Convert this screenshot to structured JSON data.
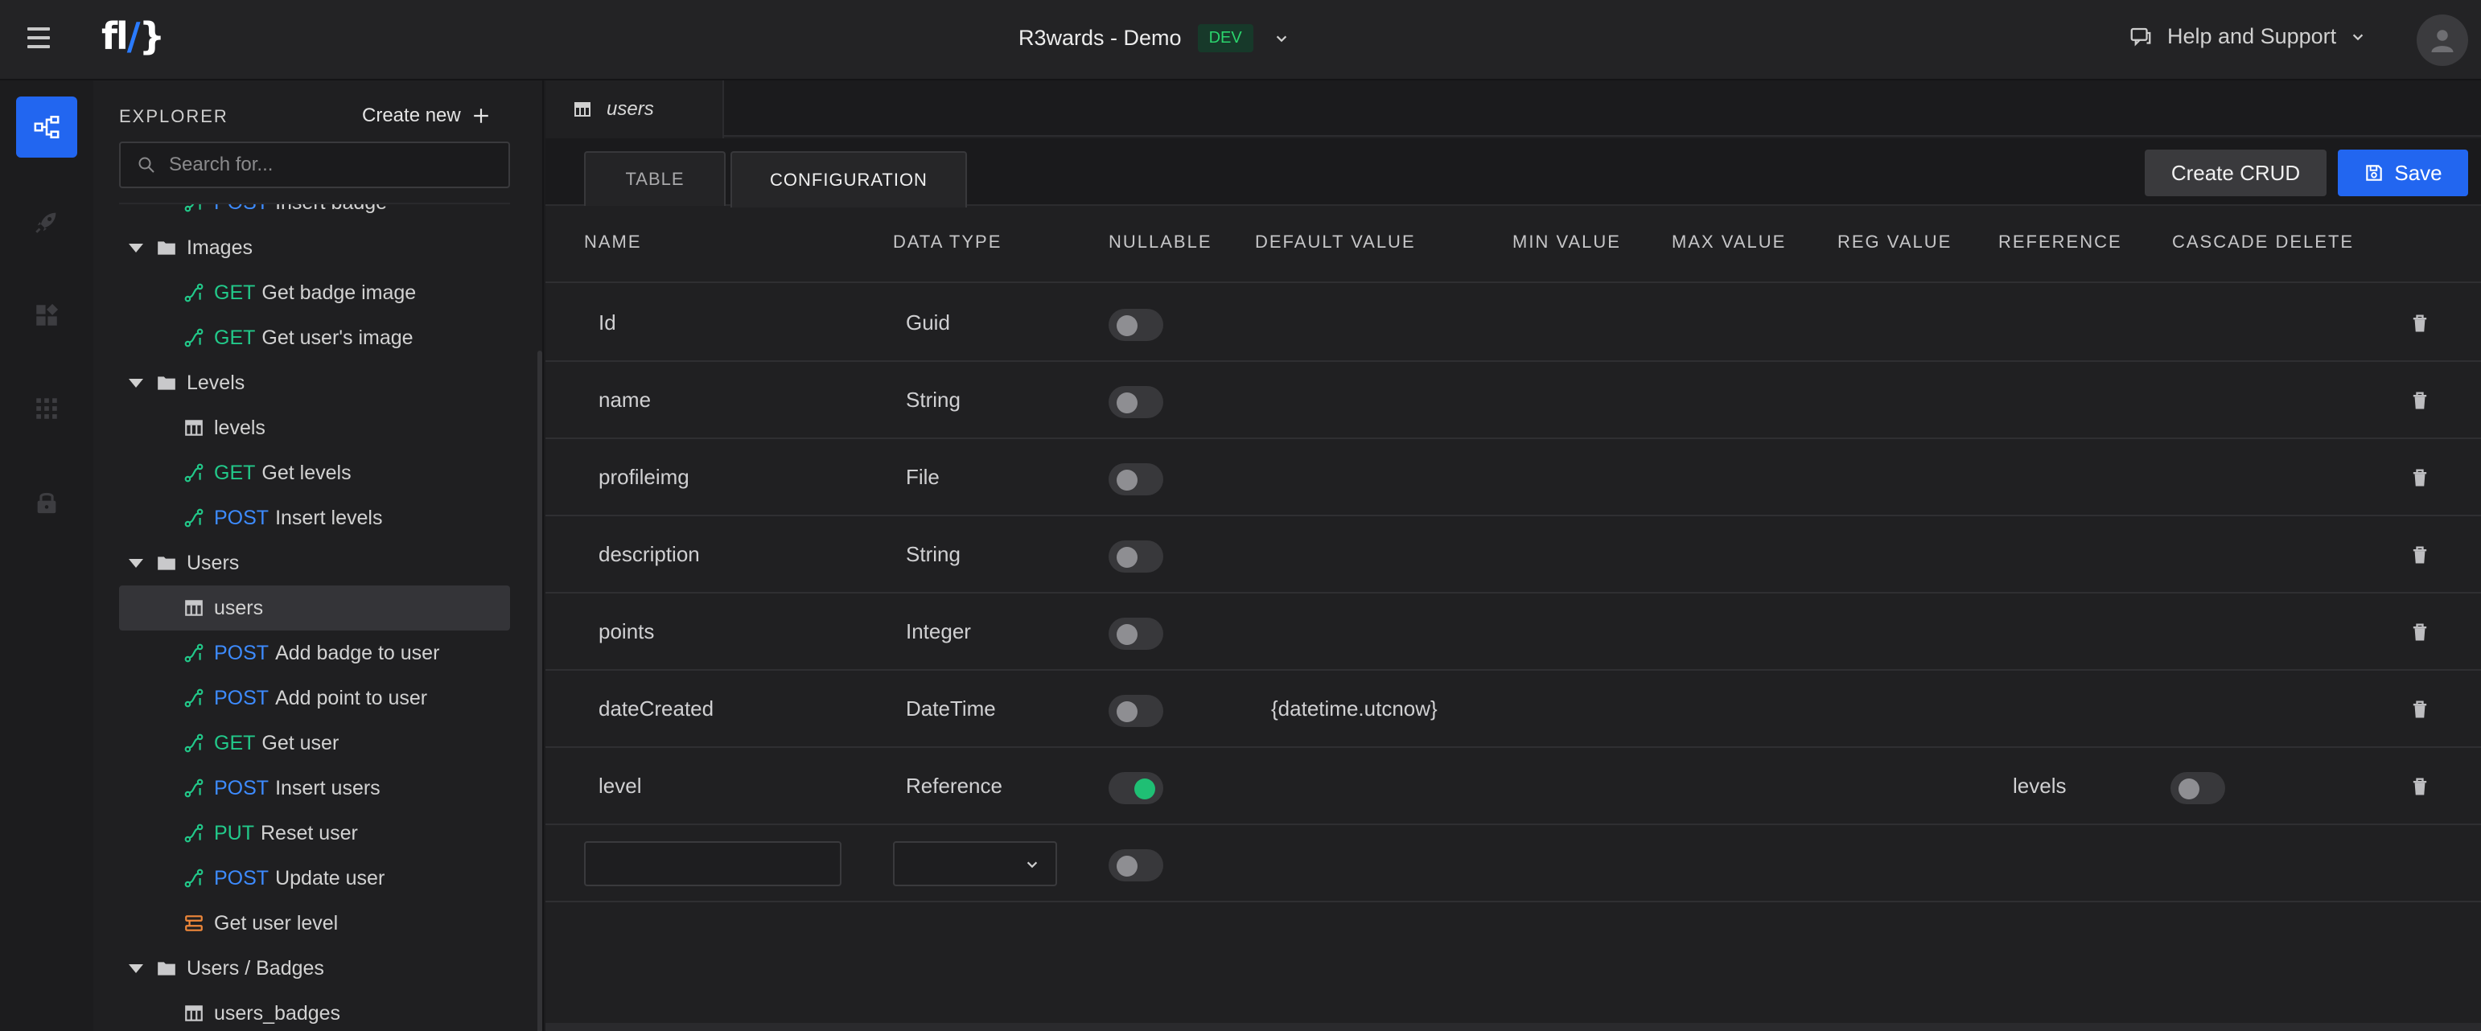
{
  "header": {
    "logo": "fl/}",
    "project_name": "R3wards - Demo",
    "env_badge": "DEV",
    "help_label": "Help and Support"
  },
  "explorer": {
    "title": "EXPLORER",
    "create_new": "Create new",
    "search_placeholder": "Search for...",
    "items": [
      {
        "kind": "leaf",
        "type": "endpoint",
        "method": "POST",
        "label": "Insert badge"
      },
      {
        "kind": "folder",
        "label": "Images"
      },
      {
        "kind": "leaf",
        "type": "endpoint",
        "method": "GET",
        "label": "Get badge image"
      },
      {
        "kind": "leaf",
        "type": "endpoint",
        "method": "GET",
        "label": "Get user's image"
      },
      {
        "kind": "folder",
        "label": "Levels"
      },
      {
        "kind": "leaf",
        "type": "table",
        "method": "",
        "label": "levels"
      },
      {
        "kind": "leaf",
        "type": "endpoint",
        "method": "GET",
        "label": "Get levels"
      },
      {
        "kind": "leaf",
        "type": "endpoint",
        "method": "POST",
        "label": "Insert levels"
      },
      {
        "kind": "folder",
        "label": "Users"
      },
      {
        "kind": "leaf",
        "type": "table",
        "method": "",
        "label": "users",
        "selected": true
      },
      {
        "kind": "leaf",
        "type": "endpoint",
        "method": "POST",
        "label": "Add badge to user"
      },
      {
        "kind": "leaf",
        "type": "endpoint",
        "method": "POST",
        "label": "Add point to user"
      },
      {
        "kind": "leaf",
        "type": "endpoint",
        "method": "GET",
        "label": "Get user"
      },
      {
        "kind": "leaf",
        "type": "endpoint",
        "method": "POST",
        "label": "Insert users"
      },
      {
        "kind": "leaf",
        "type": "endpoint",
        "method": "PUT",
        "label": "Reset user"
      },
      {
        "kind": "leaf",
        "type": "endpoint",
        "method": "POST",
        "label": "Update user"
      },
      {
        "kind": "leaf",
        "type": "function",
        "method": "",
        "label": "Get user level"
      },
      {
        "kind": "folder",
        "label": "Users / Badges"
      },
      {
        "kind": "leaf",
        "type": "table",
        "method": "",
        "label": "users_badges"
      }
    ]
  },
  "main": {
    "file_tab": "users",
    "tabs": [
      "TABLE",
      "CONFIGURATION"
    ],
    "active_tab": "CONFIGURATION",
    "create_crud": "Create CRUD",
    "save": "Save",
    "columns": [
      "NAME",
      "DATA TYPE",
      "NULLABLE",
      "DEFAULT VALUE",
      "MIN VALUE",
      "MAX VALUE",
      "REG VALUE",
      "REFERENCE",
      "CASCADE DELETE"
    ],
    "rows": [
      {
        "name": "Id",
        "type": "Guid",
        "nullable": false,
        "default": "",
        "reference": "",
        "cascade": null
      },
      {
        "name": "name",
        "type": "String",
        "nullable": false,
        "default": "",
        "reference": "",
        "cascade": null
      },
      {
        "name": "profileimg",
        "type": "File",
        "nullable": false,
        "default": "",
        "reference": "",
        "cascade": null
      },
      {
        "name": "description",
        "type": "String",
        "nullable": false,
        "default": "",
        "reference": "",
        "cascade": null
      },
      {
        "name": "points",
        "type": "Integer",
        "nullable": false,
        "default": "",
        "reference": "",
        "cascade": null
      },
      {
        "name": "dateCreated",
        "type": "DateTime",
        "nullable": false,
        "default": "{datetime.utcnow}",
        "reference": "",
        "cascade": null
      },
      {
        "name": "level",
        "type": "Reference",
        "nullable": true,
        "default": "",
        "reference": "levels",
        "cascade": false
      }
    ]
  },
  "colors": {
    "accent": "#2266f0",
    "get": "#22c98a",
    "post": "#3d8bff",
    "toggle_on": "#1fbf74"
  }
}
